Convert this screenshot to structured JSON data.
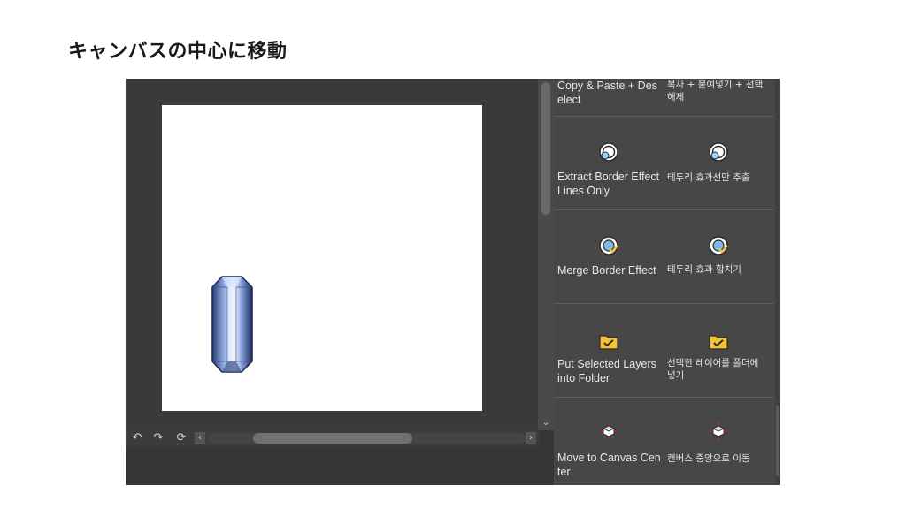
{
  "slide": {
    "title": "キャンバスの中心に移動"
  },
  "app": {
    "bottom_nav": {
      "undo_icon": "↶",
      "redo_icon": "↷",
      "rotate_icon": "⟳",
      "scroll_left": "‹",
      "scroll_right": "›",
      "scroll_down": "⌄"
    },
    "commands": [
      {
        "en": "Copy & Paste + Deselect",
        "ko": "복사 + 붙여넣기 + 선택 해제",
        "icon": "none"
      },
      {
        "en": "Extract Border Effect Lines Only",
        "ko": "테두리 효과선만 추출",
        "icon": "border-effect-icon"
      },
      {
        "en": "Merge Border Effect",
        "ko": "테두리 효과 합치기",
        "icon": "merge-border-icon"
      },
      {
        "en": "Put Selected Layers into Folder",
        "ko": "선택한 레이어를 폴더에 넣기",
        "icon": "folder-check-icon"
      },
      {
        "en": "Move to Canvas Center",
        "ko": "캔버스 중앙으로 이동",
        "icon": "canvas-center-icon"
      }
    ]
  },
  "colors": {
    "app_bg": "#3a3a3a",
    "panel_bg": "#474747",
    "folder": "#f3c534",
    "accent_red": "#d42020"
  }
}
